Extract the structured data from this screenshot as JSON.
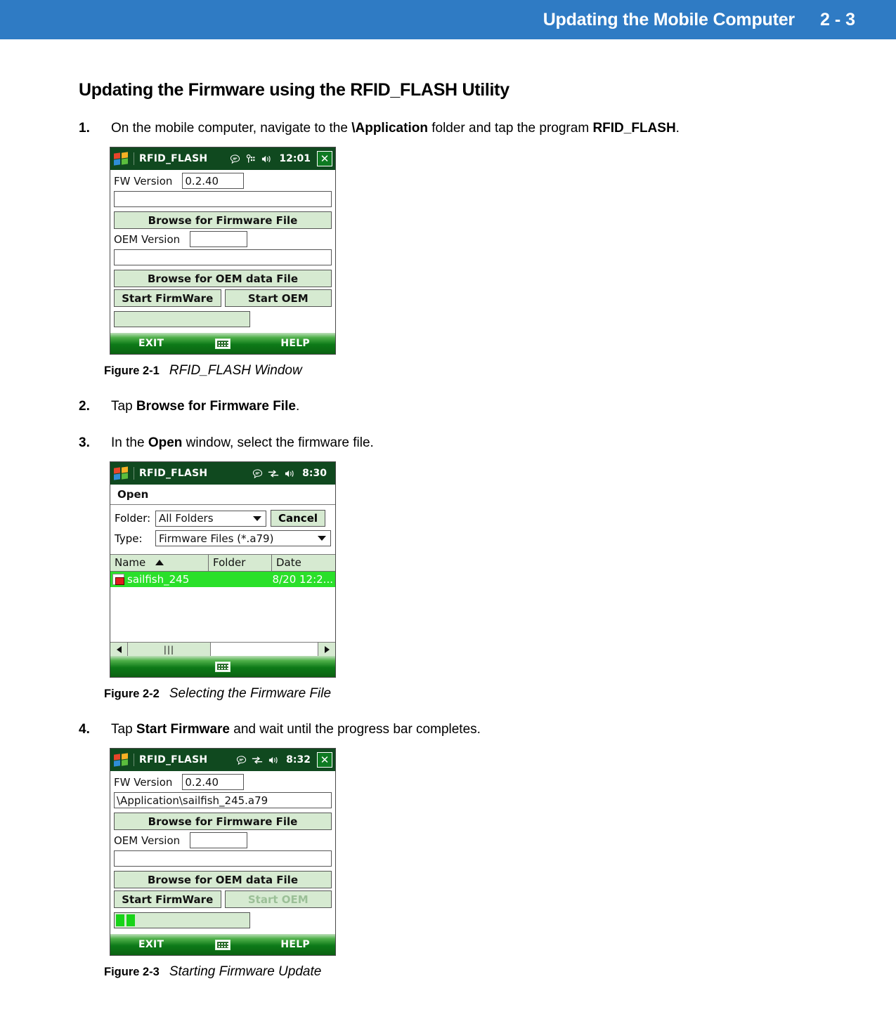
{
  "header": {
    "title": "Updating the Mobile Computer",
    "page_number": "2 - 3"
  },
  "section": {
    "heading": "Updating the Firmware using the RFID_FLASH Utility"
  },
  "steps": [
    {
      "num": "1.",
      "parts": [
        {
          "t": "On the mobile computer, navigate to the ",
          "b": false
        },
        {
          "t": "\\Application",
          "b": true
        },
        {
          "t": " folder and tap the program ",
          "b": false
        },
        {
          "t": "RFID_FLASH",
          "b": true
        },
        {
          "t": ".",
          "b": false
        }
      ]
    },
    {
      "num": "2.",
      "parts": [
        {
          "t": "Tap ",
          "b": false
        },
        {
          "t": "Browse for Firmware File",
          "b": true
        },
        {
          "t": ".",
          "b": false
        }
      ]
    },
    {
      "num": "3.",
      "parts": [
        {
          "t": "In the ",
          "b": false
        },
        {
          "t": "Open",
          "b": true
        },
        {
          "t": " window, select the firmware file.",
          "b": false
        }
      ]
    },
    {
      "num": "4.",
      "parts": [
        {
          "t": "Tap ",
          "b": false
        },
        {
          "t": "Start Firmware",
          "b": true
        },
        {
          "t": " and wait until the progress bar completes.",
          "b": false
        }
      ]
    }
  ],
  "figures": [
    {
      "number": "Figure 2-1",
      "title": "RFID_FLASH Window"
    },
    {
      "number": "Figure 2-2",
      "title": "Selecting the Firmware File"
    },
    {
      "number": "Figure 2-3",
      "title": "Starting Firmware Update"
    }
  ],
  "screenshot_1": {
    "titlebar": {
      "app_name": "RFID_FLASH",
      "icons": [
        "windows-start-icon",
        "messaging-icon",
        "connectivity-icon",
        "volume-icon"
      ],
      "time": "12:01",
      "close_label": "✕"
    },
    "fw_version_label": "FW Version",
    "fw_version_value": "0.2.40",
    "firmware_path_value": "",
    "browse_firmware_label": "Browse for Firmware File",
    "oem_version_label": "OEM Version",
    "oem_version_value": "",
    "oem_path_value": "",
    "browse_oem_label": "Browse for OEM data File",
    "start_firmware_label": "Start FirmWare",
    "start_oem_label": "Start OEM",
    "progress_segments": 0,
    "softkeys": {
      "left": "EXIT",
      "right": "HELP",
      "center_icon": "keyboard-icon"
    }
  },
  "screenshot_2": {
    "titlebar": {
      "app_name": "RFID_FLASH",
      "icons": [
        "windows-start-icon",
        "messaging-icon",
        "connectivity-icon",
        "volume-icon"
      ],
      "time": "8:30"
    },
    "dialog_title": "Open",
    "folder_label": "Folder:",
    "folder_value": "All Folders",
    "cancel_label": "Cancel",
    "type_label": "Type:",
    "type_value": "Firmware Files (*.a79)",
    "columns": [
      "Name",
      "Folder",
      "Date"
    ],
    "sort_column": "Name",
    "sort_direction": "ascending",
    "rows": [
      {
        "name": "sailfish_245",
        "folder": "",
        "date": "8/20 12:2...",
        "selected": true
      }
    ],
    "softkeys": {
      "center_icon": "keyboard-icon"
    }
  },
  "screenshot_3": {
    "titlebar": {
      "app_name": "RFID_FLASH",
      "icons": [
        "windows-start-icon",
        "messaging-icon",
        "connectivity-icon",
        "volume-icon"
      ],
      "time": "8:32",
      "close_label": "✕"
    },
    "fw_version_label": "FW Version",
    "fw_version_value": "0.2.40",
    "firmware_path_value": "\\Application\\sailfish_245.a79",
    "browse_firmware_label": "Browse for Firmware File",
    "oem_version_label": "OEM Version",
    "oem_version_value": "",
    "oem_path_value": "",
    "browse_oem_label": "Browse for OEM data File",
    "start_firmware_label": "Start FirmWare",
    "start_oem_label": "Start OEM",
    "start_oem_disabled": true,
    "progress_segments": 2,
    "softkeys": {
      "left": "EXIT",
      "right": "HELP",
      "center_icon": "keyboard-icon"
    }
  },
  "colors": {
    "header_blue": "#2f7bc4",
    "titlebar_green": "#10491f",
    "button_face": "#d6ead1",
    "selection_green": "#2ae02a",
    "progress_green": "#18d318"
  }
}
